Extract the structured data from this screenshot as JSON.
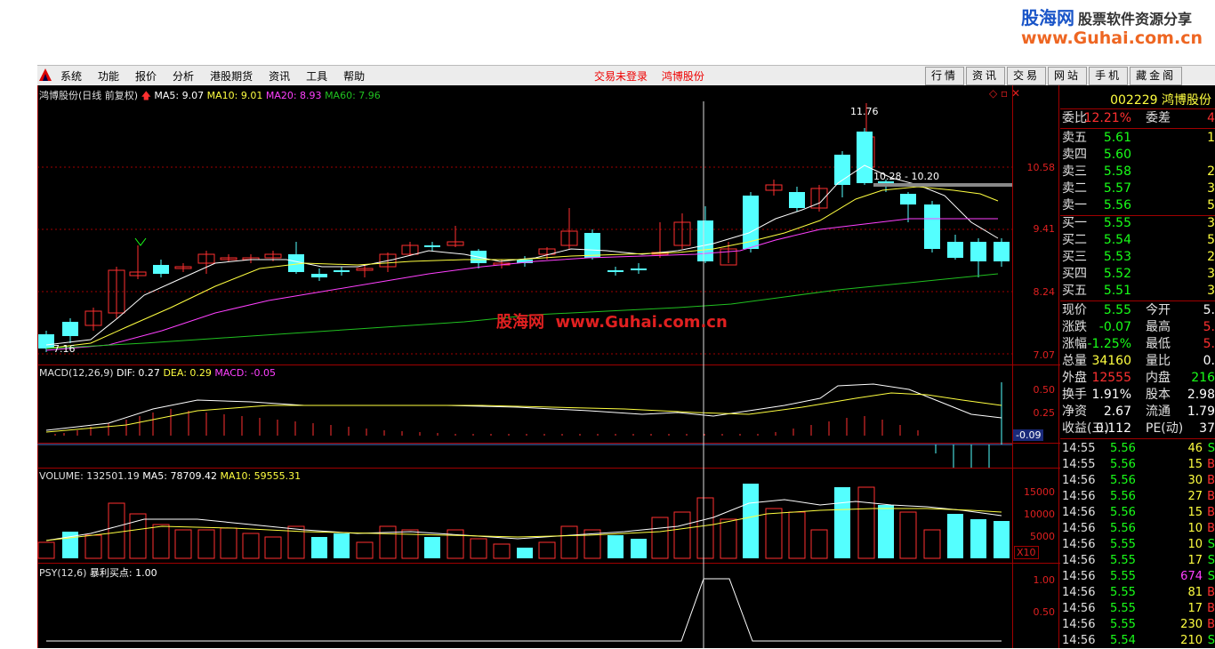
{
  "watermark": {
    "site_cn": "股海网",
    "slogan": "股票软件资源分享",
    "url": "www.Guhai.com.cn",
    "overlay_cn": "股海网",
    "overlay_url": "www.Guhai.com.cn"
  },
  "menu": {
    "items": [
      "系统",
      "功能",
      "报价",
      "分析",
      "港股期货",
      "资讯",
      "工具",
      "帮助"
    ],
    "status": "交易未登录",
    "stock": "鸿博股份",
    "buttons": [
      "行情",
      "资讯",
      "交易",
      "网站",
      "手机",
      "藏金阁"
    ]
  },
  "kline": {
    "title": "鸿博股份(日线 前复权)",
    "ma5": "MA5: 9.07",
    "ma10": "MA10: 9.01",
    "ma20": "MA20: 8.93",
    "ma60": "MA60: 7.96",
    "high_label": "11.76",
    "range_label": "10.28 - 10.20",
    "low_label": "7.16",
    "axis": [
      "10.58",
      "9.41",
      "8.24",
      "7.07"
    ]
  },
  "macd": {
    "title": "MACD(12,26,9)",
    "dif": "DIF: 0.27",
    "dea": "DEA: 0.29",
    "macd": "MACD: -0.05",
    "axis": [
      "0.50",
      "0.25"
    ],
    "current": "-0.09"
  },
  "volume": {
    "title": "VOLUME: 132501.19",
    "ma5": "MA5: 78709.42",
    "ma10": "MA10: 59555.31",
    "axis": [
      "15000",
      "10000",
      "5000"
    ],
    "unit": "X10"
  },
  "psy": {
    "title": "PSY(12,6)",
    "signal": "暴利买点: 1.00",
    "axis": [
      "1.00",
      "0.50"
    ]
  },
  "colors": {
    "up": "#ff3030",
    "down": "#54ffff",
    "ma5": "#ffffff",
    "ma10": "#ffff40",
    "ma20": "#ff40ff",
    "ma60": "#20c020",
    "grid": "#a00000"
  },
  "quote": {
    "code": "002229",
    "name": "鸿博股份",
    "weibi": {
      "k": "委比",
      "v": "12.21%",
      "k2": "委差",
      "v2": "4"
    },
    "sell": [
      {
        "k": "卖五",
        "p": "5.61",
        "q": "1"
      },
      {
        "k": "卖四",
        "p": "5.60",
        "q": ""
      },
      {
        "k": "卖三",
        "p": "5.58",
        "q": "2"
      },
      {
        "k": "卖二",
        "p": "5.57",
        "q": "3"
      },
      {
        "k": "卖一",
        "p": "5.56",
        "q": "5"
      }
    ],
    "buy": [
      {
        "k": "买一",
        "p": "5.55",
        "q": "3"
      },
      {
        "k": "买二",
        "p": "5.54",
        "q": "5"
      },
      {
        "k": "买三",
        "p": "5.53",
        "q": "2"
      },
      {
        "k": "买四",
        "p": "5.52",
        "q": "3"
      },
      {
        "k": "买五",
        "p": "5.51",
        "q": "3"
      }
    ],
    "stats": [
      {
        "k": "现价",
        "v": "5.55",
        "k2": "今开",
        "v2": "5."
      },
      {
        "k": "涨跌",
        "v": "-0.07",
        "k2": "最高",
        "v2": "5."
      },
      {
        "k": "涨幅",
        "v": "-1.25%",
        "k2": "最低",
        "v2": "5."
      },
      {
        "k": "总量",
        "v": "34160",
        "k2": "量比",
        "v2": "0."
      },
      {
        "k": "外盘",
        "v": "12555",
        "k2": "内盘",
        "v2": "216"
      },
      {
        "k": "换手",
        "v": "1.91%",
        "k2": "股本",
        "v2": "2.98"
      },
      {
        "k": "净资",
        "v": "2.67",
        "k2": "流通",
        "v2": "1.79"
      },
      {
        "k": "收益(三)",
        "v": "0.112",
        "k2": "PE(动)",
        "v2": "37"
      }
    ],
    "ticks": [
      {
        "t": "14:55",
        "p": "5.56",
        "v": "46",
        "s": "S"
      },
      {
        "t": "14:55",
        "p": "5.56",
        "v": "15",
        "s": "B"
      },
      {
        "t": "14:56",
        "p": "5.56",
        "v": "30",
        "s": "B"
      },
      {
        "t": "14:56",
        "p": "5.56",
        "v": "27",
        "s": "B"
      },
      {
        "t": "14:56",
        "p": "5.56",
        "v": "15",
        "s": "B"
      },
      {
        "t": "14:56",
        "p": "5.56",
        "v": "10",
        "s": "B"
      },
      {
        "t": "14:56",
        "p": "5.55",
        "v": "10",
        "s": "S"
      },
      {
        "t": "14:56",
        "p": "5.55",
        "v": "17",
        "s": "S"
      },
      {
        "t": "14:56",
        "p": "5.55",
        "v": "674",
        "s": "S"
      },
      {
        "t": "14:56",
        "p": "5.55",
        "v": "81",
        "s": "B"
      },
      {
        "t": "14:56",
        "p": "5.55",
        "v": "17",
        "s": "B"
      },
      {
        "t": "14:56",
        "p": "5.55",
        "v": "230",
        "s": "B"
      },
      {
        "t": "14:56",
        "p": "5.54",
        "v": "210",
        "s": "S"
      }
    ]
  }
}
